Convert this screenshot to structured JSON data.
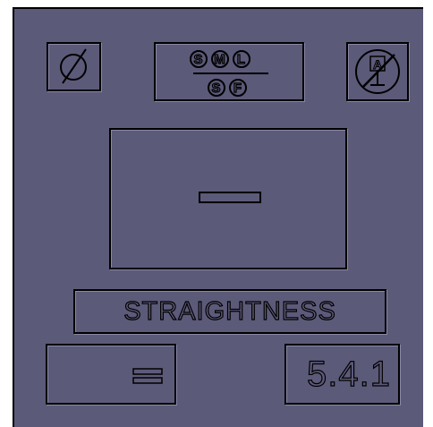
{
  "gdt": {
    "symbols": {
      "diameter_icon": "diameter-symbol",
      "free_state_icon": "no-air-gauge-symbol"
    },
    "material_condition": {
      "top_row": [
        "S",
        "M",
        "L"
      ],
      "bottom_row": [
        "S",
        "F"
      ]
    },
    "characteristic_symbol": "—",
    "characteristic_name": "STRAIGHTNESS",
    "equals_symbol": "=",
    "section_number": "5.4.1"
  },
  "colors": {
    "panel_bg": "#5c5a79",
    "outline": "#000000",
    "highlight": "#8a88a6"
  }
}
